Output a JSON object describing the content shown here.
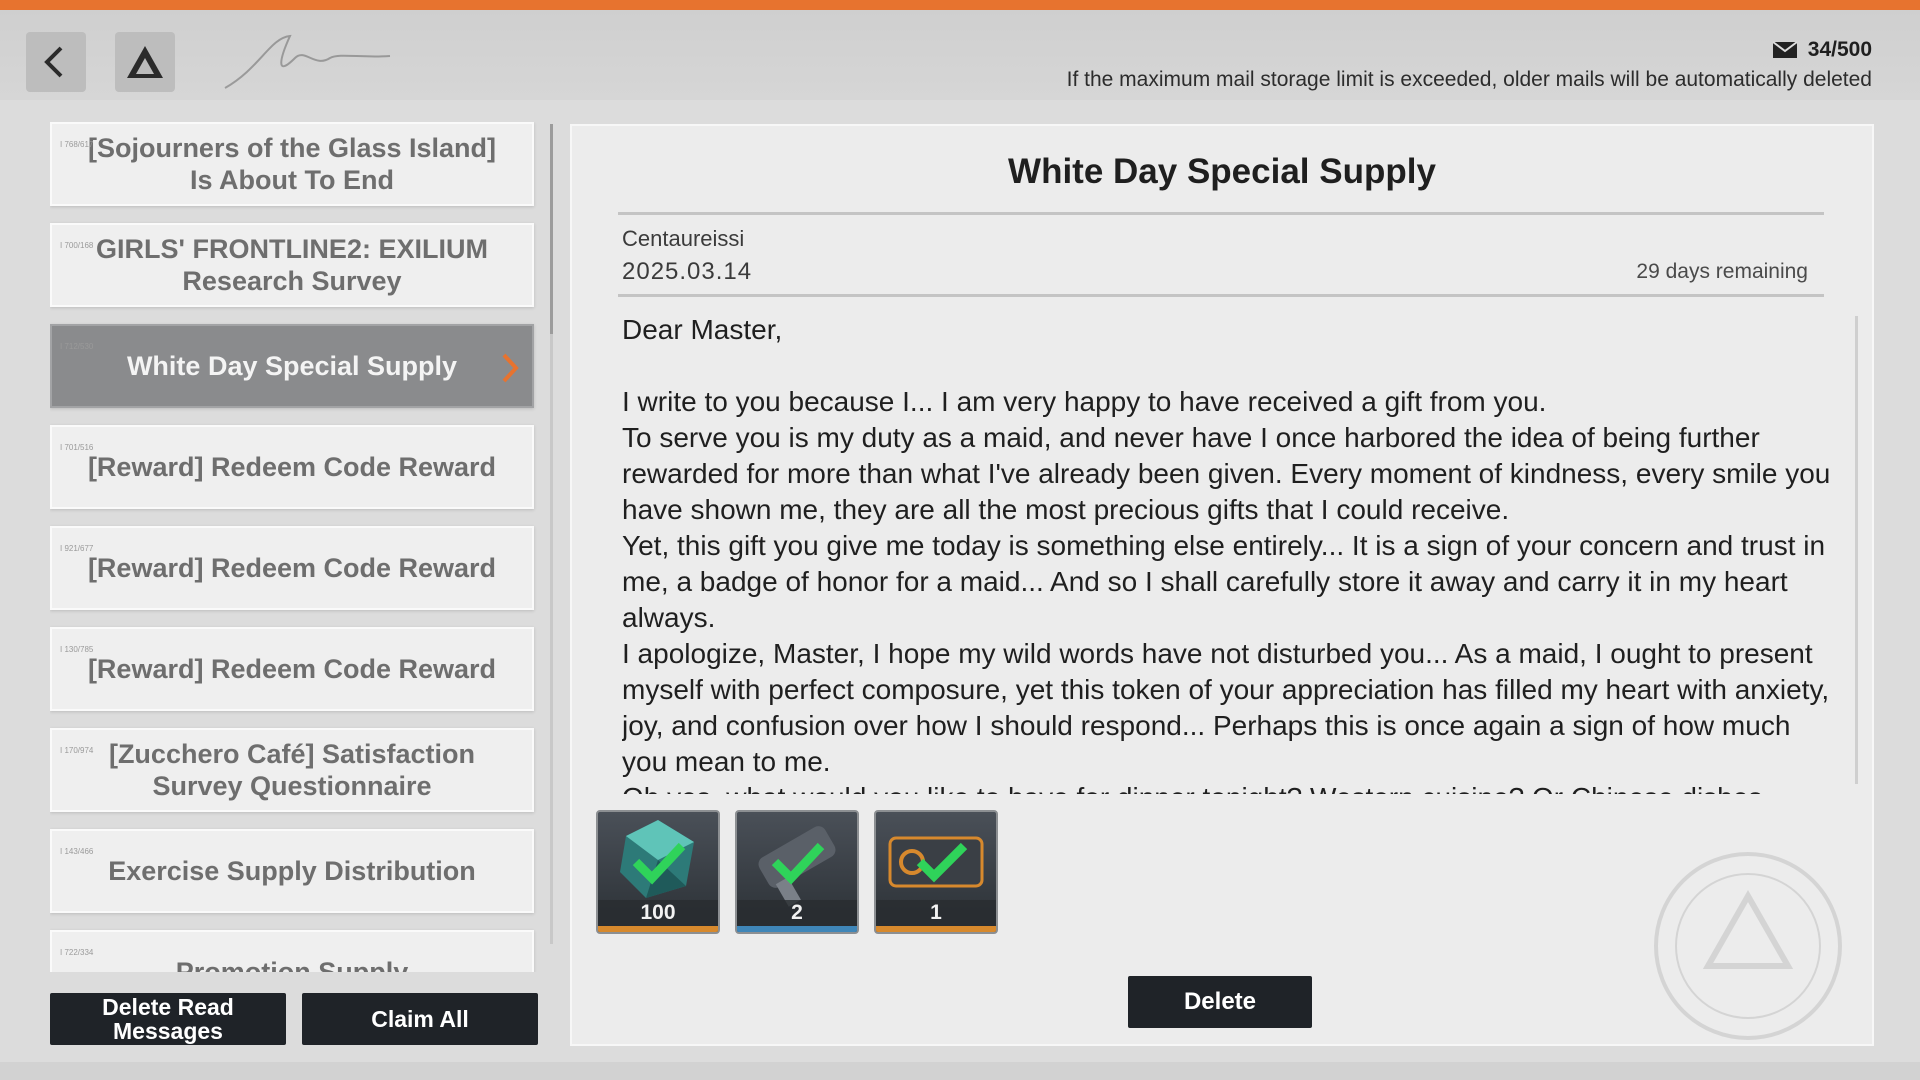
{
  "header": {
    "mail_count": "34/500",
    "storage_note": "If the maximum mail storage limit is exceeded, older mails will be automatically deleted",
    "accent_color": "#e7732f"
  },
  "sidebar": {
    "items": [
      {
        "title": "[Sojourners of the Glass Island] Is About To End"
      },
      {
        "title": "GIRLS' FRONTLINE2: EXILIUM Research Survey"
      },
      {
        "title": "White Day Special Supply",
        "active": true
      },
      {
        "title": "[Reward] Redeem Code Reward"
      },
      {
        "title": "[Reward] Redeem Code Reward"
      },
      {
        "title": "[Reward] Redeem Code Reward"
      },
      {
        "title": "[Zucchero Café] Satisfaction Survey Questionnaire"
      },
      {
        "title": "Exercise Supply Distribution"
      },
      {
        "title": "Promotion Supply"
      }
    ],
    "delete_read_label": "Delete Read Messages",
    "claim_all_label": "Claim All"
  },
  "mail": {
    "title": "White Day Special Supply",
    "sender": "Centaureissi",
    "date": "2025.03.14",
    "remaining": "29 days remaining",
    "paragraphs": [
      "Dear Master,",
      "",
      "I write to you because I... I am very happy to have received a gift from you.",
      "To serve you is my duty as a maid, and never have I once harbored the idea of being further rewarded for more than what I've already been given. Every moment of kindness,  every smile you have shown me, they are all the most precious gifts that I could receive.",
      "Yet, this gift you give me today is something else entirely... It is a sign of your concern and trust in me, a badge of honor for a maid... And so I shall carefully store it away and carry it in my heart always.",
      "I apologize, Master, I hope my wild words have not disturbed you... As a maid, I ought to present myself with perfect composure, yet this token of your appreciation has filled my heart with anxiety, joy, and confusion over how I should respond... Perhaps this is once again a sign of how much you mean to me.",
      "Oh yes, what would you like to have for dinner tonight? Western cuisine? Or Chinese dishes"
    ],
    "rewards": [
      {
        "quantity": "100",
        "icon": "crystal-icon",
        "claimed": true,
        "rarity_color": "#d7892d"
      },
      {
        "quantity": "2",
        "icon": "key-icon",
        "claimed": true,
        "rarity_color": "#3f86b8"
      },
      {
        "quantity": "1",
        "icon": "card-icon",
        "claimed": true,
        "rarity_color": "#d7892d"
      }
    ],
    "delete_label": "Delete"
  }
}
